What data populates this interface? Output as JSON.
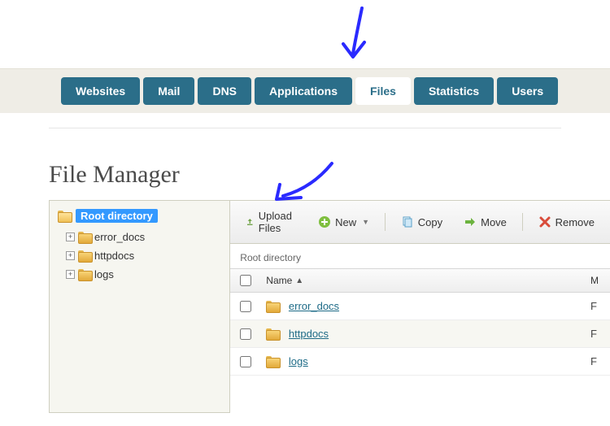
{
  "nav": {
    "tabs": [
      {
        "label": "Websites",
        "active": false
      },
      {
        "label": "Mail",
        "active": false
      },
      {
        "label": "DNS",
        "active": false
      },
      {
        "label": "Applications",
        "active": false
      },
      {
        "label": "Files",
        "active": true
      },
      {
        "label": "Statistics",
        "active": false
      },
      {
        "label": "Users",
        "active": false
      }
    ]
  },
  "page": {
    "title": "File Manager"
  },
  "tree": {
    "root_label": "Root directory",
    "items": [
      {
        "label": "error_docs"
      },
      {
        "label": "httpdocs"
      },
      {
        "label": "logs"
      }
    ]
  },
  "toolbar": {
    "upload_label": "Upload Files",
    "new_label": "New",
    "copy_label": "Copy",
    "move_label": "Move",
    "remove_label": "Remove"
  },
  "breadcrumb": "Root directory",
  "grid": {
    "columns": {
      "name": "Name",
      "m": "M"
    },
    "rows": [
      {
        "name": "error_docs",
        "m": "F"
      },
      {
        "name": "httpdocs",
        "m": "F"
      },
      {
        "name": "logs",
        "m": "F"
      }
    ]
  }
}
